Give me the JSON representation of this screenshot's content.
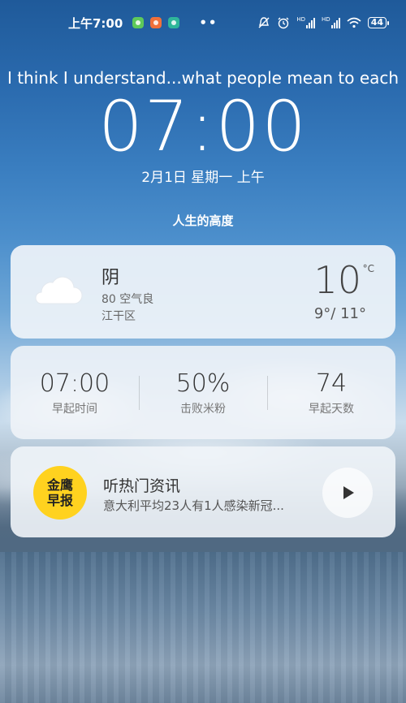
{
  "status_bar": {
    "time": "上午7:00",
    "more": "••",
    "network_labels": [
      "HD",
      "HD"
    ],
    "battery": "44"
  },
  "marquee": "I think I understand...what people mean to each",
  "clock": {
    "time": "07:00",
    "date": "2月1日  星期一  上午"
  },
  "motto": "人生的高度",
  "weather": {
    "condition": "阴",
    "air_quality": "80 空气良",
    "location": "江干区",
    "temperature": "10",
    "unit": "°C",
    "range": "9°/ 11°"
  },
  "stats": [
    {
      "value": "07:00",
      "label": "早起时间"
    },
    {
      "value": "50%",
      "label": "击败米粉"
    },
    {
      "value": "74",
      "label": "早起天数"
    }
  ],
  "news": {
    "logo_line1": "金鹰",
    "logo_line2": "早报",
    "title": "听热门资讯",
    "subtitle": "意大利平均23人有1人感染新冠..."
  },
  "colors": {
    "logo_yellow": "#ffd21f",
    "logo_red": "#e23a2a"
  }
}
